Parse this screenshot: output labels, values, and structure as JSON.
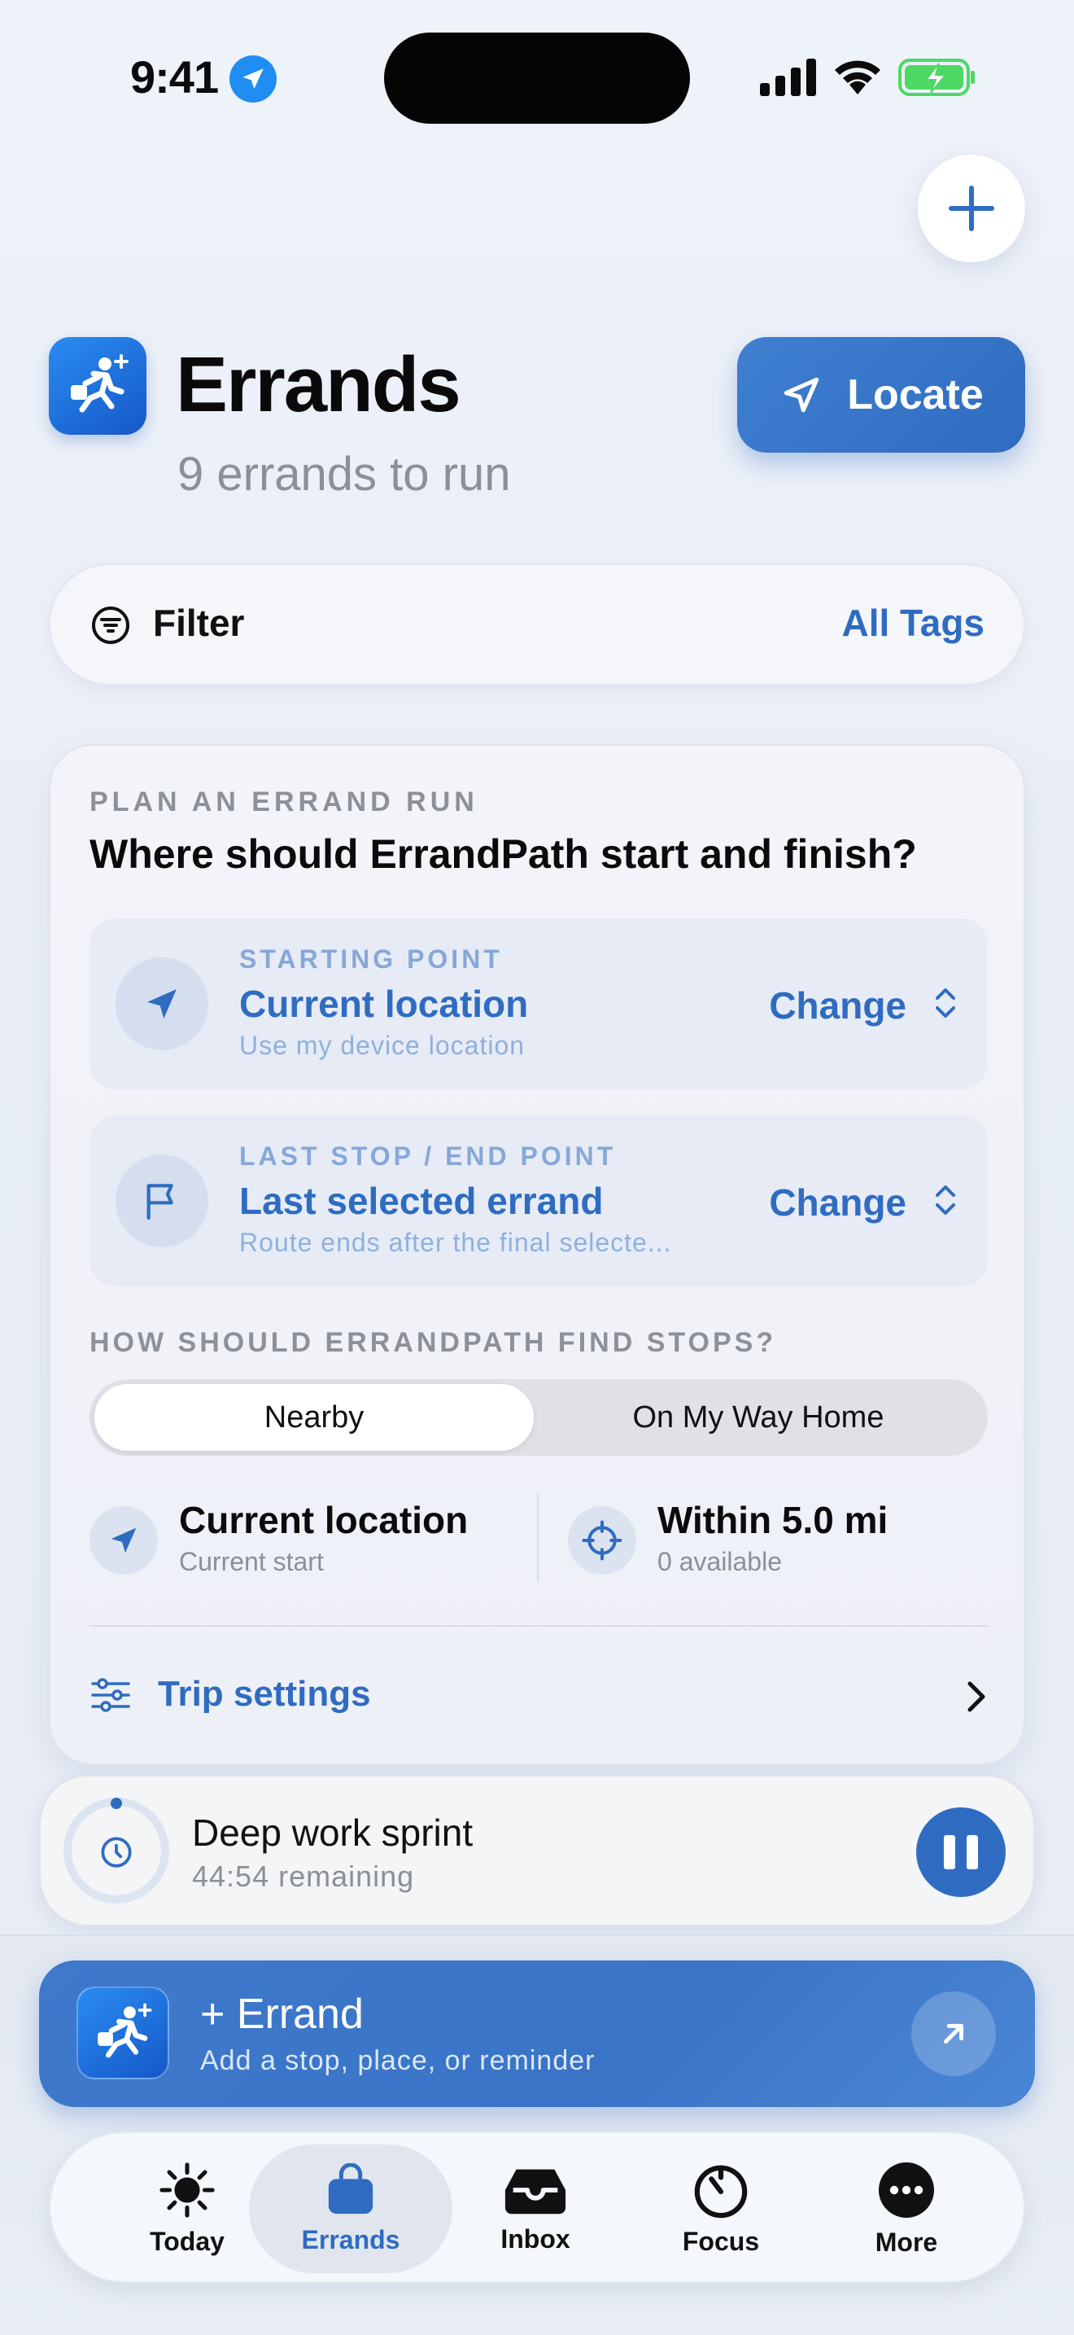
{
  "status_bar": {
    "time": "9:41"
  },
  "header": {
    "title": "Errands",
    "subtitle": "9 errands to run",
    "locate_label": "Locate"
  },
  "filter": {
    "label": "Filter",
    "tags_label": "All Tags"
  },
  "plan": {
    "eyebrow": "PLAN AN ERRAND RUN",
    "question": "Where should ErrandPath start and finish?",
    "start": {
      "eyebrow": "STARTING POINT",
      "main": "Current location",
      "sub": "Use my device location",
      "change_label": "Change"
    },
    "end": {
      "eyebrow": "LAST STOP / END POINT",
      "main": "Last selected errand",
      "sub": "Route ends after the final selecte...",
      "change_label": "Change"
    },
    "find_eyebrow": "HOW SHOULD ERRANDPATH FIND STOPS?",
    "modes": [
      {
        "label": "Nearby",
        "selected": true
      },
      {
        "label": "On My Way Home",
        "selected": false
      }
    ],
    "stats": [
      {
        "main": "Current location",
        "sub": "Current start",
        "icon": "location-arrow-icon"
      },
      {
        "main": "Within 5.0 mi",
        "sub": "0 available",
        "icon": "crosshair-icon"
      }
    ],
    "trip_settings_label": "Trip settings"
  },
  "focus": {
    "title": "Deep work sprint",
    "remaining": "44:54 remaining"
  },
  "add_errand": {
    "title": "+ Errand",
    "subtitle": "Add a stop, place, or reminder"
  },
  "tabs": [
    {
      "label": "Today",
      "icon": "sun-icon",
      "active": false
    },
    {
      "label": "Errands",
      "icon": "bag-icon",
      "active": true
    },
    {
      "label": "Inbox",
      "icon": "inbox-icon",
      "active": false
    },
    {
      "label": "Focus",
      "icon": "timer-icon",
      "active": false
    },
    {
      "label": "More",
      "icon": "more-icon",
      "active": false
    }
  ],
  "colors": {
    "accent": "#2f6cc1",
    "background": "#eef2f9",
    "battery": "#4cd964",
    "location_dot": "#1f8df2"
  }
}
